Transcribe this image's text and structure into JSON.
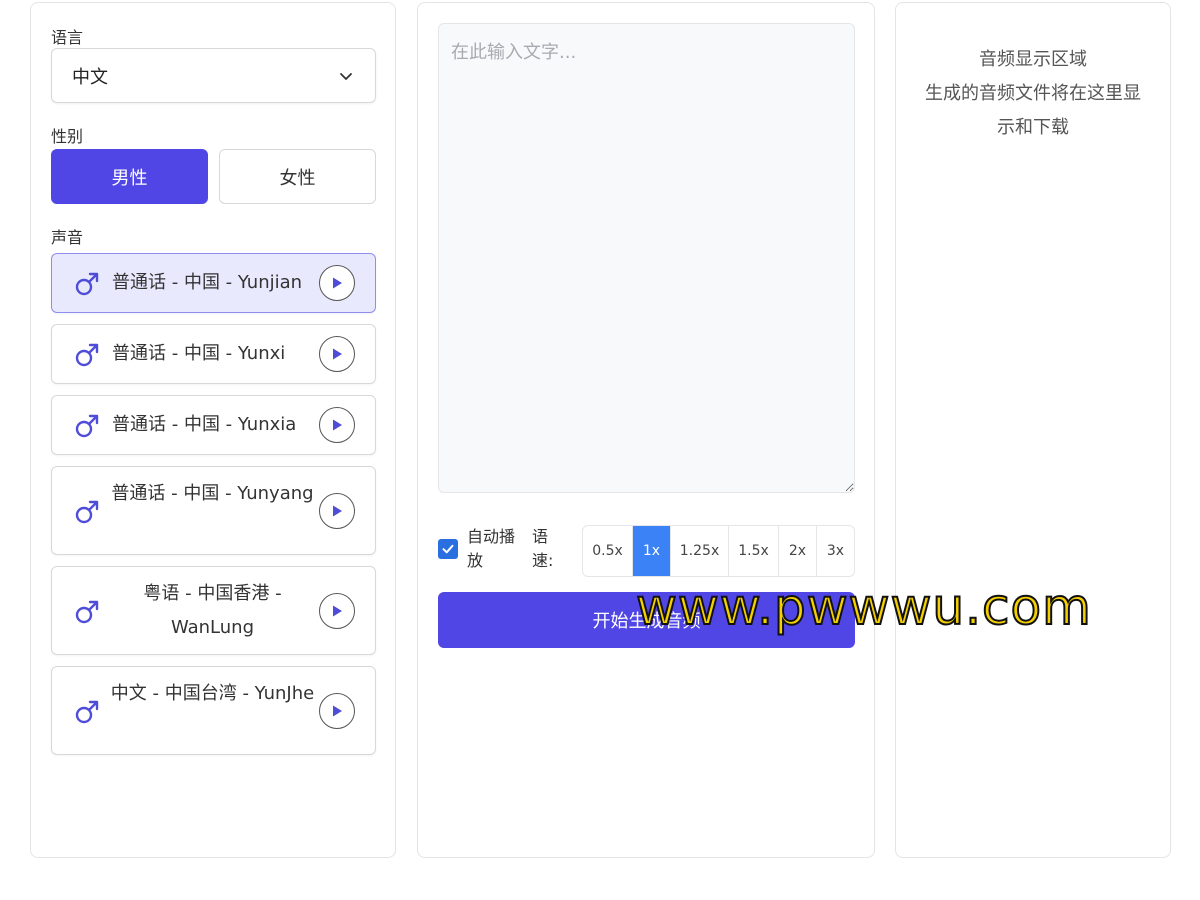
{
  "left": {
    "language_label": "语言",
    "language_value": "中文",
    "gender_label": "性别",
    "gender_male": "男性",
    "gender_female": "女性",
    "voice_label": "声音",
    "voices": [
      {
        "name": "普通话 - 中国 - Yunjian",
        "selected": true
      },
      {
        "name": "普通话 - 中国 - Yunxi",
        "selected": false
      },
      {
        "name": "普通话 - 中国 - Yunxia",
        "selected": false
      },
      {
        "name": "普通话 - 中国 - Yunyang",
        "selected": false
      },
      {
        "name": "粤语 - 中国香港 - WanLung",
        "selected": false
      },
      {
        "name": "中文 - 中国台湾 - YunJhe",
        "selected": false
      }
    ]
  },
  "middle": {
    "text_placeholder": "在此输入文字...",
    "autoplay_label": "自动播放",
    "autoplay_checked": true,
    "speed_label": "语速:",
    "speeds": [
      "0.5x",
      "1x",
      "1.25x",
      "1.5x",
      "2x",
      "3x"
    ],
    "speed_selected": "1x",
    "generate_label": "开始生成音频"
  },
  "right": {
    "audio_title": "音频显示区域",
    "audio_desc": "生成的音频文件将在这里显示和下载"
  },
  "watermark": "www.pwwwu.com",
  "colors": {
    "primary": "#5046e5",
    "speed_active": "#3b82f6",
    "checkbox": "#2a6fe0"
  }
}
